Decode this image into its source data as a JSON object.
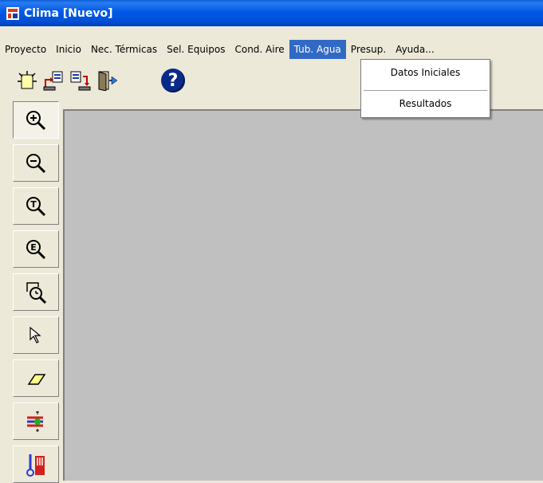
{
  "window": {
    "title": "Clima [Nuevo]"
  },
  "menubar": {
    "items": [
      {
        "label": "Proyecto"
      },
      {
        "label": "Inicio"
      },
      {
        "label": "Nec. Térmicas"
      },
      {
        "label": "Sel. Equipos"
      },
      {
        "label": "Cond. Aire"
      },
      {
        "label": "Tub. Agua",
        "active": true
      },
      {
        "label": "Presup."
      },
      {
        "label": "Ayuda..."
      }
    ]
  },
  "dropdown": {
    "items": [
      {
        "label": "Datos Iniciales"
      },
      {
        "label": "Resultados"
      }
    ]
  },
  "toolbar": {
    "buttons": [
      {
        "icon": "new-project-icon"
      },
      {
        "icon": "open-project-icon"
      },
      {
        "icon": "save-project-icon"
      },
      {
        "icon": "exit-icon"
      },
      {
        "icon": "help-icon",
        "glyph": "?"
      }
    ]
  },
  "sidebar": {
    "tools": [
      {
        "icon": "zoom-in-icon"
      },
      {
        "icon": "zoom-out-icon"
      },
      {
        "icon": "zoom-total-icon",
        "glyph": "T"
      },
      {
        "icon": "zoom-extents-icon",
        "glyph": "E"
      },
      {
        "icon": "zoom-window-icon"
      },
      {
        "icon": "select-pointer-icon"
      },
      {
        "icon": "eraser-icon"
      },
      {
        "icon": "pipe-tool-icon"
      },
      {
        "icon": "thermometer-radiator-icon"
      }
    ]
  },
  "colors": {
    "accent": "#316ac5",
    "titlebar": "#0058e6",
    "canvas": "#c0c0c0",
    "face": "#ece9d8"
  }
}
